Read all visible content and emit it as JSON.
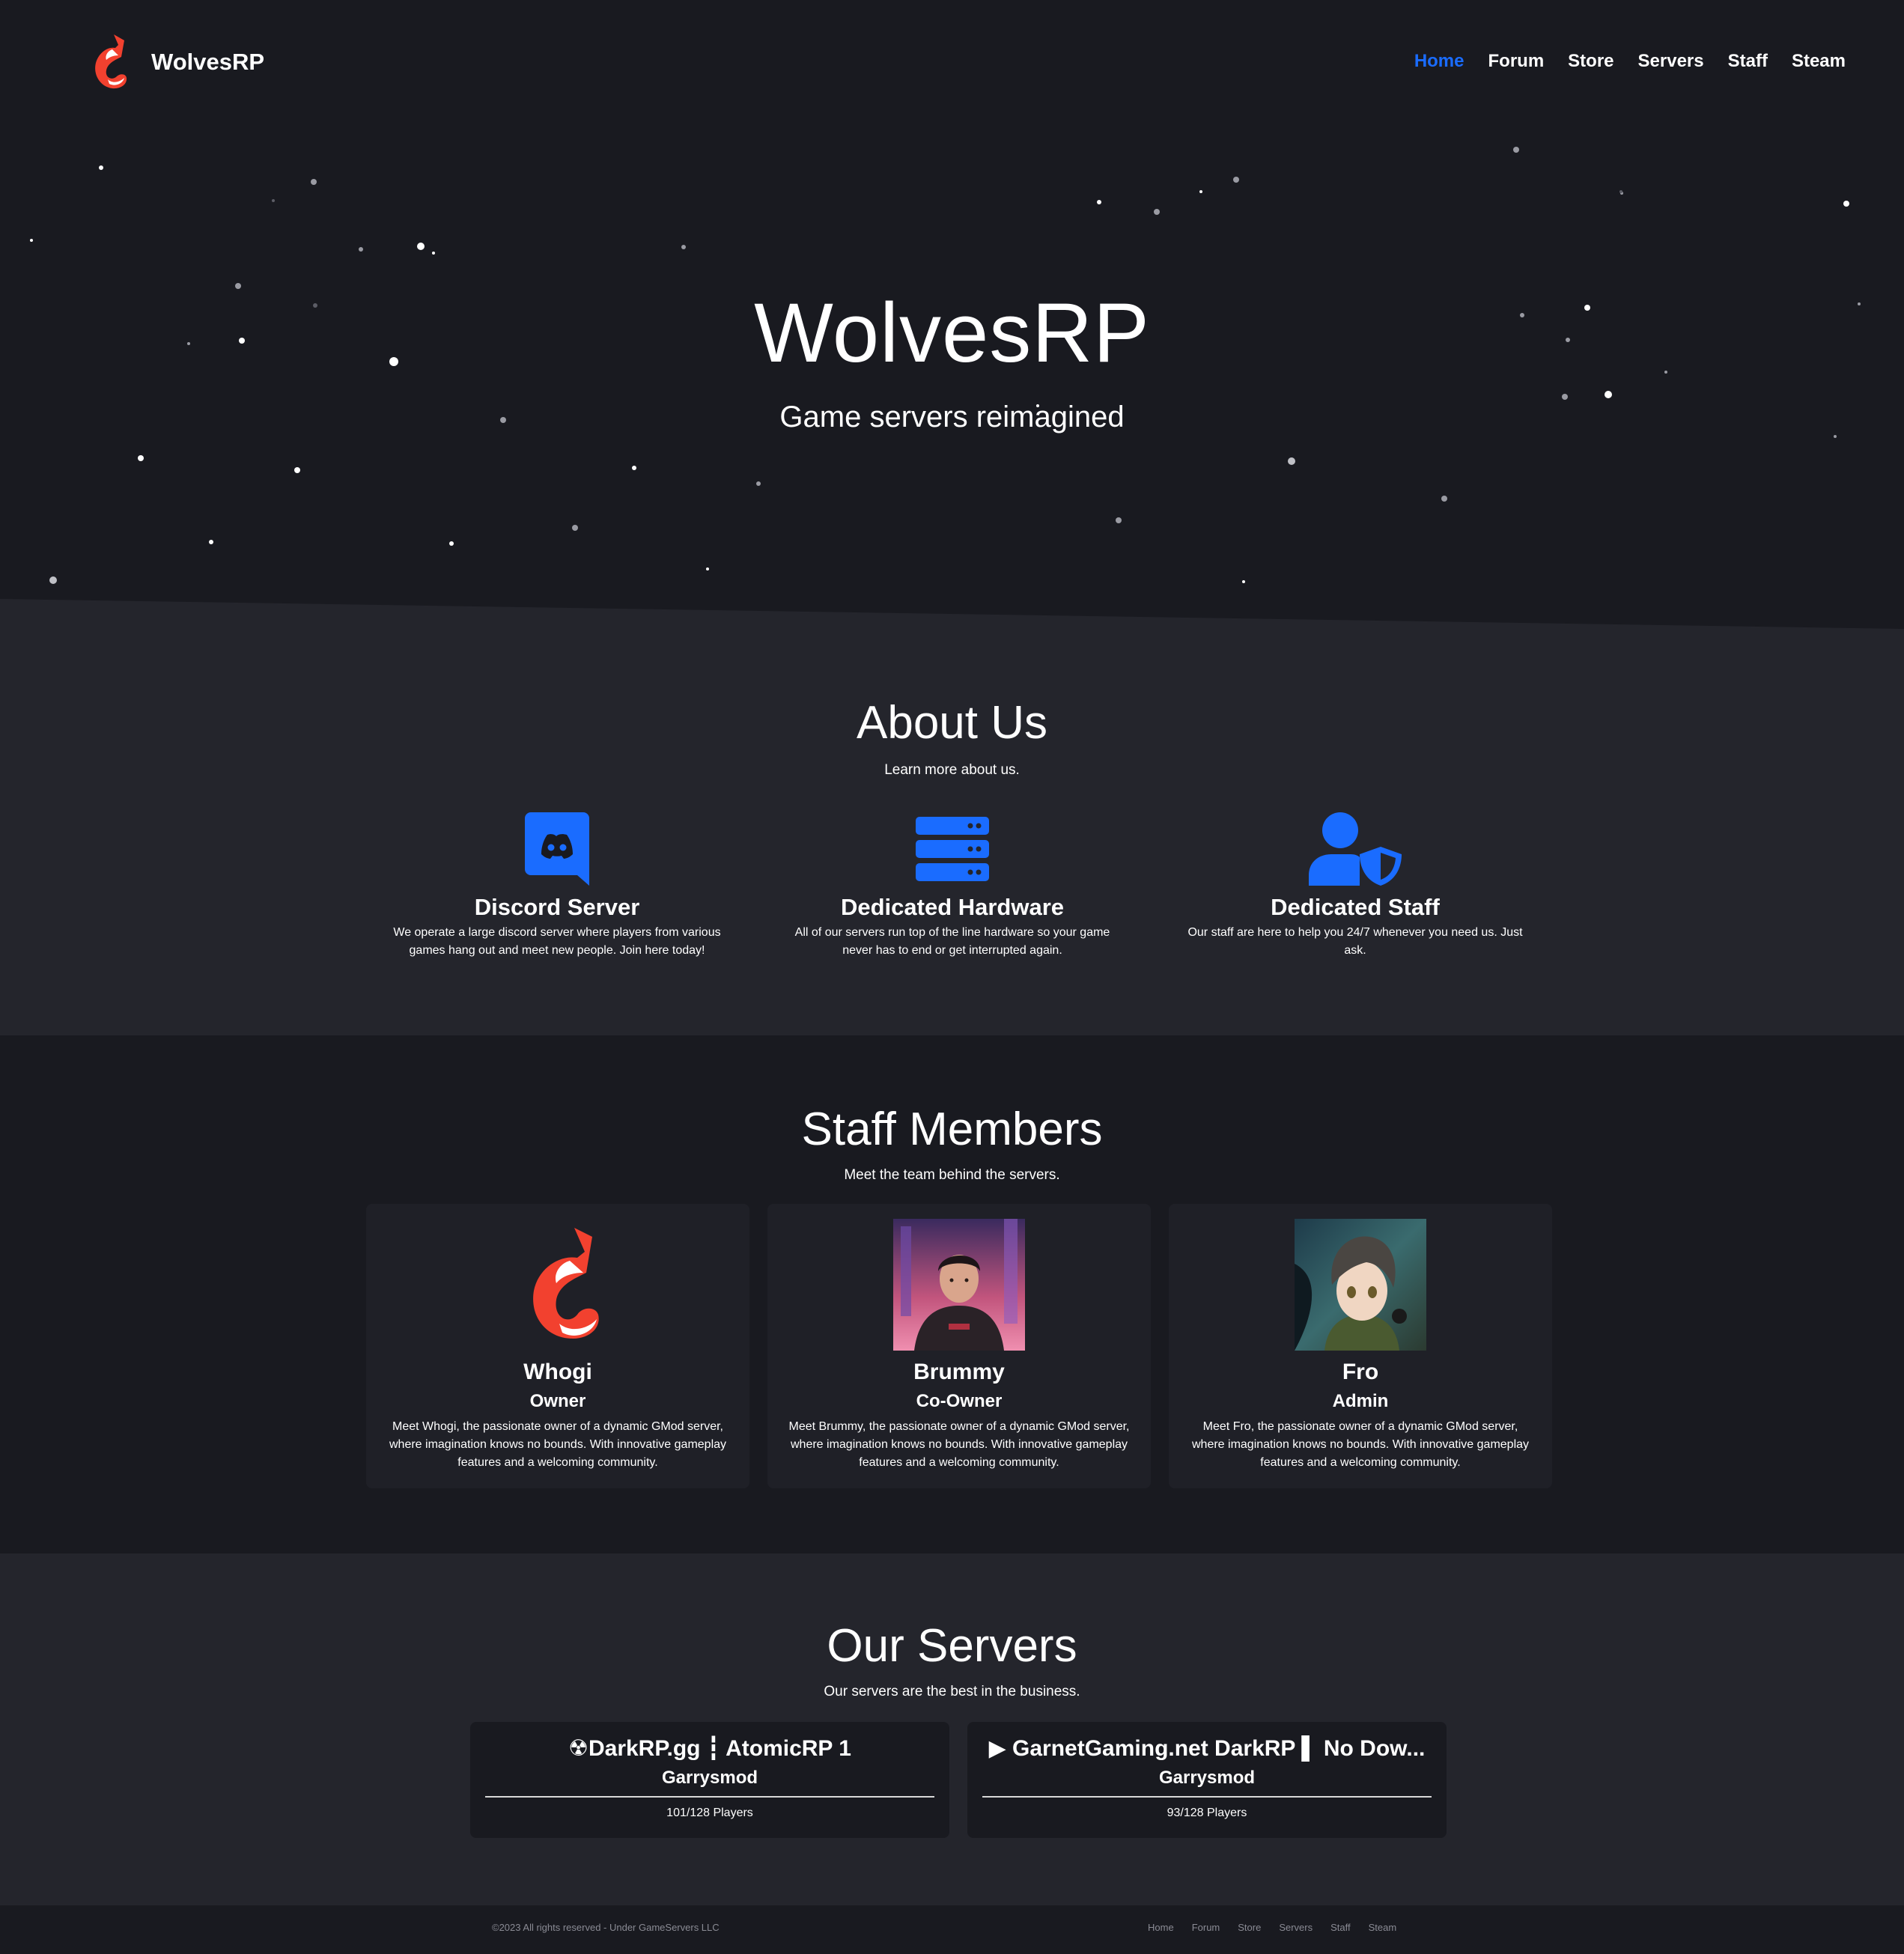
{
  "brand": {
    "name": "WolvesRP",
    "logo_icon": "fox-logo-icon"
  },
  "nav": {
    "items": [
      {
        "label": "Home",
        "active": true
      },
      {
        "label": "Forum",
        "active": false
      },
      {
        "label": "Store",
        "active": false
      },
      {
        "label": "Servers",
        "active": false
      },
      {
        "label": "Staff",
        "active": false
      },
      {
        "label": "Steam",
        "active": false
      }
    ]
  },
  "hero": {
    "title": "WolvesRP",
    "subtitle": "Game servers reimagined"
  },
  "about": {
    "title": "About Us",
    "subtitle": "Learn more about us.",
    "features": [
      {
        "icon": "discord-icon",
        "title": "Discord Server",
        "text": "We operate a large discord server where players from various games hang out and meet new people. Join here today!"
      },
      {
        "icon": "server-rack-icon",
        "title": "Dedicated Hardware",
        "text": "All of our servers run top of the line hardware so your game never has to end or get interrupted again."
      },
      {
        "icon": "user-shield-icon",
        "title": "Dedicated Staff",
        "text": "Our staff are here to help you 24/7 whenever you need us. Just ask."
      }
    ]
  },
  "staff": {
    "title": "Staff Members",
    "subtitle": "Meet the team behind the servers.",
    "members": [
      {
        "name": "Whogi",
        "role": "Owner",
        "text": "Meet Whogi, the passionate owner of a dynamic GMod server, where imagination knows no bounds. With innovative gameplay features and a welcoming community."
      },
      {
        "name": "Brummy",
        "role": "Co-Owner",
        "text": "Meet Brummy, the passionate owner of a dynamic GMod server, where imagination knows no bounds. With innovative gameplay features and a welcoming community."
      },
      {
        "name": "Fro",
        "role": "Admin",
        "text": "Meet Fro, the passionate owner of a dynamic GMod server, where imagination knows no bounds. With innovative gameplay features and a welcoming community."
      }
    ]
  },
  "servers": {
    "title": "Our Servers",
    "subtitle": "Our servers are the best in the business.",
    "list": [
      {
        "name": "☢DarkRP.gg ┇ AtomicRP 1",
        "game": "Garrysmod",
        "players": "101/128 Players"
      },
      {
        "name": "▶ GarnetGaming.net DarkRP ▌ No Dow...",
        "game": "Garrysmod",
        "players": "93/128 Players"
      }
    ]
  },
  "footer": {
    "copyright": "©2023 All rights reserved - Under GameServers LLC",
    "links": [
      "Home",
      "Forum",
      "Store",
      "Servers",
      "Staff",
      "Steam"
    ]
  },
  "colors": {
    "accent": "#1a6cff",
    "fox": "#f2412f",
    "bg_dark": "#191a20",
    "bg_light": "#24252c",
    "card": "#1f2027"
  }
}
